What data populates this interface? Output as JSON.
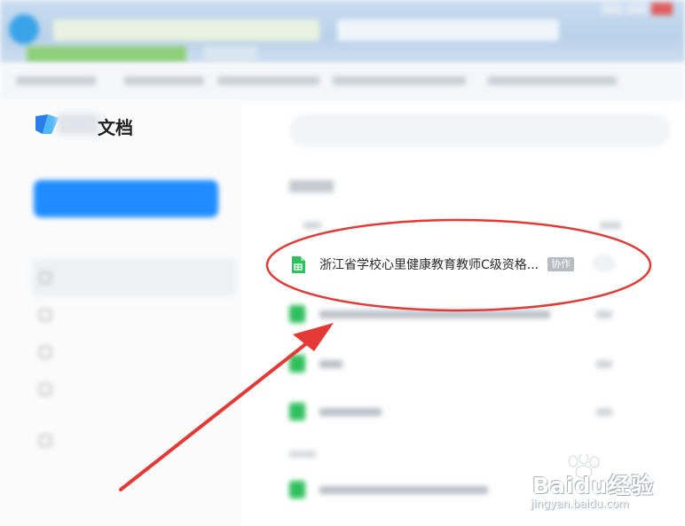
{
  "app": {
    "logo_text": "文档"
  },
  "file_list": {
    "highlighted_item": {
      "name": "浙江省学校心里健康教育教师C级资格...",
      "badge": "协作",
      "icon": "sheet-file-icon"
    }
  },
  "watermark": {
    "brand": "Baidu经验",
    "url": "jingyan.baidu.com"
  },
  "colors": {
    "accent_blue": "#1f8dff",
    "sheet_green": "#2fbf5c",
    "annotation_red": "#e53935"
  }
}
